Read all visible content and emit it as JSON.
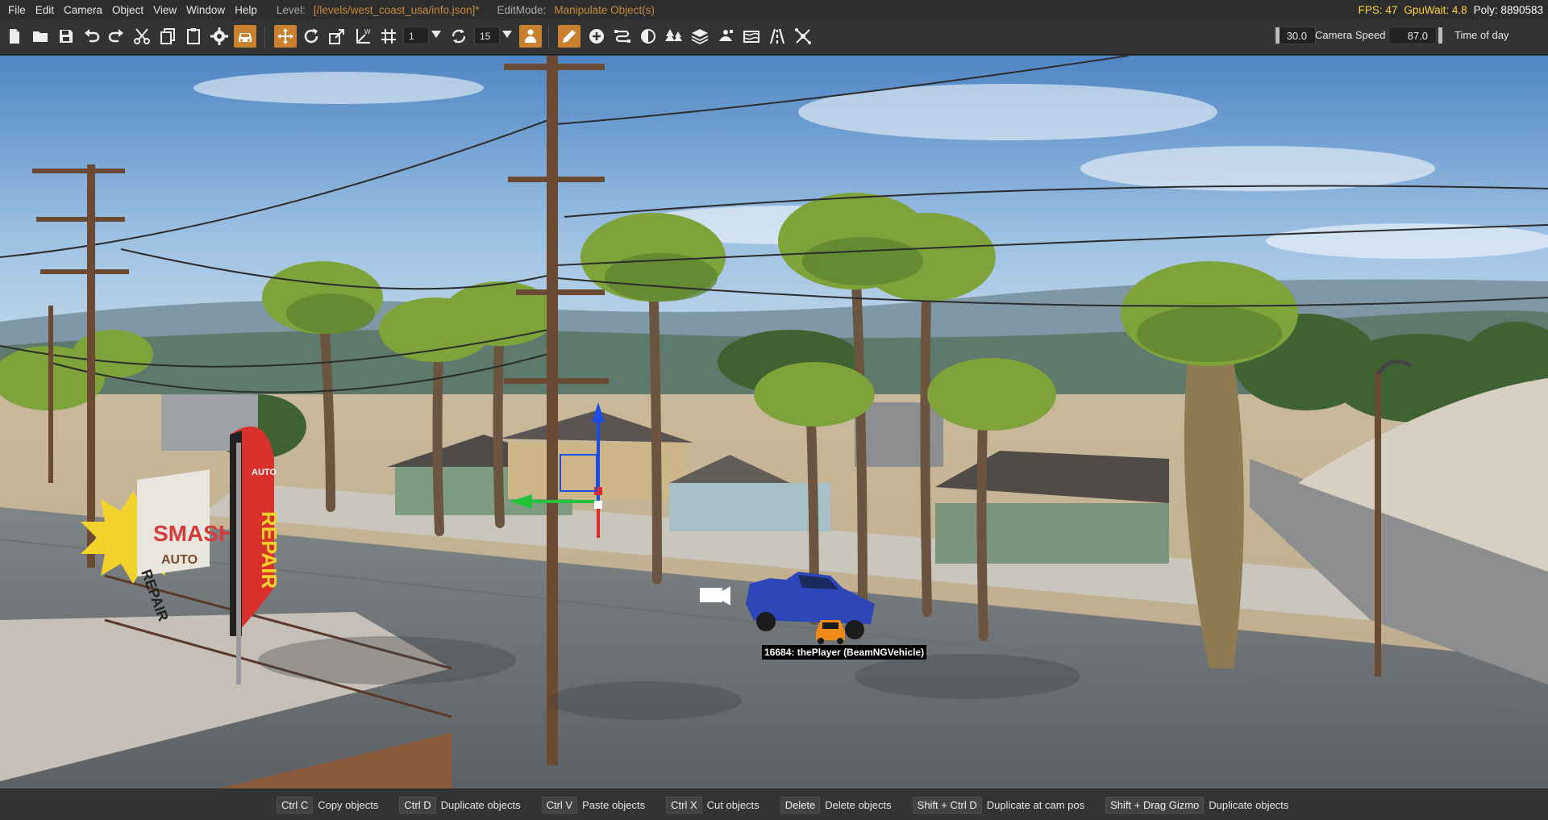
{
  "menu": {
    "items": [
      "File",
      "Edit",
      "Camera",
      "Object",
      "View",
      "Window",
      "Help"
    ],
    "level_label": "Level:",
    "level_path": "[/levels/west_coast_usa/info.json]*",
    "editmode_label": "EditMode:",
    "editmode_value": "Manipulate Object(s)"
  },
  "stats": {
    "fps": "FPS: 47",
    "gpu_wait": "GpuWait: 4.8",
    "poly": "Poly: 8890583"
  },
  "toolbar": {
    "grid_count": "1",
    "snap_angle": "15",
    "camera_speed_value": "30.0",
    "camera_speed_label": "Camera Speed",
    "time_of_day_value": "87.0",
    "time_of_day_label": "Time of day",
    "active_color": "#c9812f",
    "icons": [
      "new-file-icon",
      "open-folder-icon",
      "save-icon",
      "undo-icon",
      "redo-icon",
      "cut-icon",
      "copy-icon",
      "paste-icon",
      "settings-gear-icon",
      "vehicle-icon",
      "translate-gizmo-icon",
      "rotate-gizmo-icon",
      "scale-gizmo-icon",
      "axis-gizmo-icon",
      "grid-snap-icon",
      "rotation-snap-icon",
      "place-object-icon",
      "edit-pencil-icon",
      "add-object-icon",
      "road-tool-icon",
      "terrain-paint-icon",
      "forest-icon",
      "layers-icon",
      "decal-icon",
      "river-icon",
      "road-lines-icon",
      "node-tool-icon"
    ]
  },
  "viewport": {
    "selected_object_label": "16684: thePlayer (BeamNGVehicle)",
    "signs": {
      "smash": "SMASH",
      "auto": "AUTO",
      "repair": "REPAIR",
      "banner": "REPAIR",
      "banner_top": "AUTO"
    }
  },
  "shortcuts": [
    {
      "key": "Ctrl C",
      "action": "Copy objects"
    },
    {
      "key": "Ctrl D",
      "action": "Duplicate objects"
    },
    {
      "key": "Ctrl V",
      "action": "Paste objects"
    },
    {
      "key": "Ctrl X",
      "action": "Cut objects"
    },
    {
      "key": "Delete",
      "action": "Delete objects"
    },
    {
      "key": "Shift + Ctrl D",
      "action": "Duplicate at cam pos"
    },
    {
      "key": "Shift + Drag Gizmo",
      "action": "Duplicate objects"
    }
  ]
}
